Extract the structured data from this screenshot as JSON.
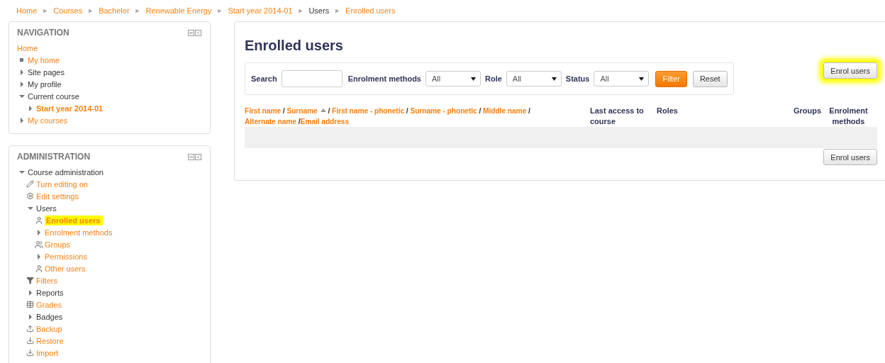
{
  "breadcrumb": {
    "separator": "►",
    "items": [
      {
        "label": "Home",
        "link": true
      },
      {
        "label": "Courses",
        "link": true
      },
      {
        "label": "Bachelor",
        "link": true
      },
      {
        "label": "Renewable Energy",
        "link": true
      },
      {
        "label": "Start year 2014-01",
        "link": true
      },
      {
        "label": "Users",
        "link": false
      },
      {
        "label": "Enrolled users",
        "link": true
      }
    ]
  },
  "blocks": [
    {
      "title": "NAVIGATION",
      "items": [
        {
          "label": "Home",
          "kind": "plain",
          "link": true
        },
        {
          "label": "My home",
          "kind": "bullet",
          "link": true
        },
        {
          "label": "Site pages",
          "kind": "branch",
          "expanded": false,
          "link": false
        },
        {
          "label": "My profile",
          "kind": "branch",
          "expanded": false,
          "link": false
        },
        {
          "label": "Current course",
          "kind": "branch",
          "expanded": true,
          "link": false,
          "children": [
            {
              "label": "Start year 2014-01",
              "kind": "branch",
              "expanded": false,
              "link": true,
              "bold": true
            }
          ]
        },
        {
          "label": "My courses",
          "kind": "branch",
          "expanded": false,
          "link": true
        }
      ]
    },
    {
      "title": "ADMINISTRATION",
      "items": [
        {
          "label": "Course administration",
          "kind": "branch",
          "expanded": true,
          "link": false,
          "children": [
            {
              "label": "Turn editing on",
              "kind": "edit",
              "link": true
            },
            {
              "label": "Edit settings",
              "kind": "settings",
              "link": true
            },
            {
              "label": "Users",
              "kind": "branch",
              "expanded": true,
              "link": false,
              "children": [
                {
                  "label": "Enrolled users",
                  "kind": "user",
                  "link": true,
                  "bold": true,
                  "highlighted": true
                },
                {
                  "label": "Enrolment methods",
                  "kind": "branch",
                  "expanded": false,
                  "link": true
                },
                {
                  "label": "Groups",
                  "kind": "group",
                  "link": true
                },
                {
                  "label": "Permissions",
                  "kind": "branch",
                  "expanded": false,
                  "link": true
                },
                {
                  "label": "Other users",
                  "kind": "user",
                  "link": true
                }
              ]
            },
            {
              "label": "Filters",
              "kind": "filter",
              "link": true
            },
            {
              "label": "Reports",
              "kind": "branch",
              "expanded": false,
              "link": false
            },
            {
              "label": "Grades",
              "kind": "grades",
              "link": true
            },
            {
              "label": "Badges",
              "kind": "branch",
              "expanded": false,
              "link": false
            },
            {
              "label": "Backup",
              "kind": "backup",
              "link": true
            },
            {
              "label": "Restore",
              "kind": "restore",
              "link": true
            },
            {
              "label": "Import",
              "kind": "import",
              "link": true
            }
          ]
        }
      ]
    }
  ],
  "main": {
    "title": "Enrolled users",
    "filters": {
      "search_label": "Search",
      "selects": [
        {
          "label": "Enrolment methods",
          "value": "All"
        },
        {
          "label": "Role",
          "value": "All"
        },
        {
          "label": "Status",
          "value": "All"
        }
      ],
      "buttons": [
        {
          "label": "Filter",
          "primary": true
        },
        {
          "label": "Reset",
          "primary": false
        }
      ]
    },
    "enrol_button_top": {
      "label": "Enrol users",
      "highlighted": true
    },
    "table": {
      "name_column": {
        "separator": "/",
        "links": [
          {
            "label": "First name",
            "sorted": false
          },
          {
            "label": "Surname",
            "sorted": true
          },
          {
            "label": "First name - phonetic",
            "sorted": false
          },
          {
            "label": "Surname - phonetic",
            "sorted": false
          },
          {
            "label": "Middle name",
            "sorted": false
          },
          {
            "label": "Alternate name",
            "sorted": false
          },
          {
            "label": "Email address",
            "sorted": false
          }
        ]
      },
      "columns": [
        "Last access to course",
        "Roles",
        "Groups",
        "Enrolment methods"
      ]
    },
    "enrol_button_bottom": {
      "label": "Enrol users",
      "highlighted": false
    }
  }
}
